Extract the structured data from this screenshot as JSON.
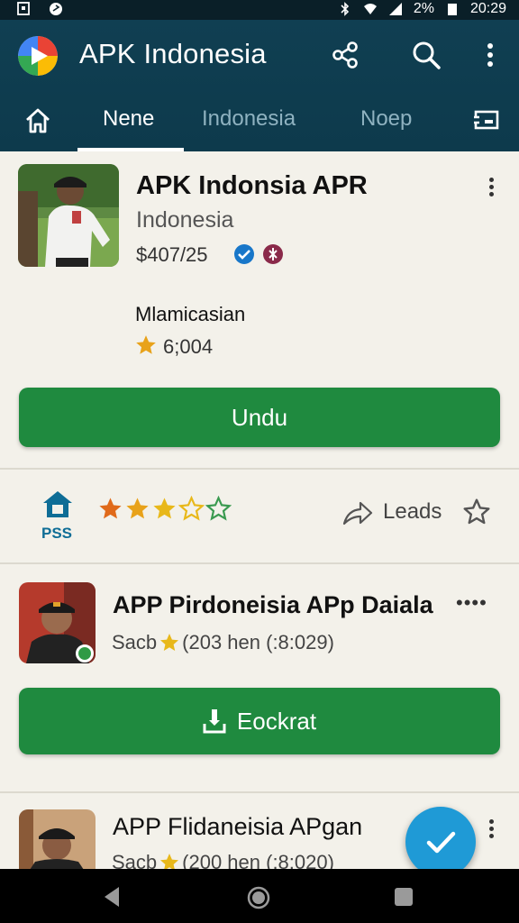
{
  "status_bar": {
    "battery": "2%",
    "time": "20:29"
  },
  "app_bar": {
    "title": "APK Indonesia"
  },
  "tabs": [
    {
      "label": "Nene"
    },
    {
      "label": "Indonesia"
    },
    {
      "label": "Noep"
    }
  ],
  "featured": {
    "title": "APK Indonsia APR",
    "subtitle": "Indonesia",
    "price": "$407/25",
    "category": "Mlamicasian",
    "rating_count": "6;004",
    "button_label": "Undu"
  },
  "action_row": {
    "badge_label": "PSS",
    "stars_filled": 3,
    "stars_total": 5,
    "leads_label": "Leads"
  },
  "list": [
    {
      "title": "APP Pirdoneisia APp Daiala",
      "meta_prefix": "Sacb",
      "meta_suffix": "(203 hen (:8:029)",
      "more": "••••",
      "button_label": "Eockrat"
    },
    {
      "title": "APP Flidaneisia APgan",
      "meta_prefix": "Sacb",
      "meta_suffix": "(200 hen (:8:020)"
    }
  ],
  "colors": {
    "app_bar": "#103f52",
    "primary_button": "#1f8a3f",
    "fab": "#1f9ad6",
    "star": "#e8a21a"
  }
}
